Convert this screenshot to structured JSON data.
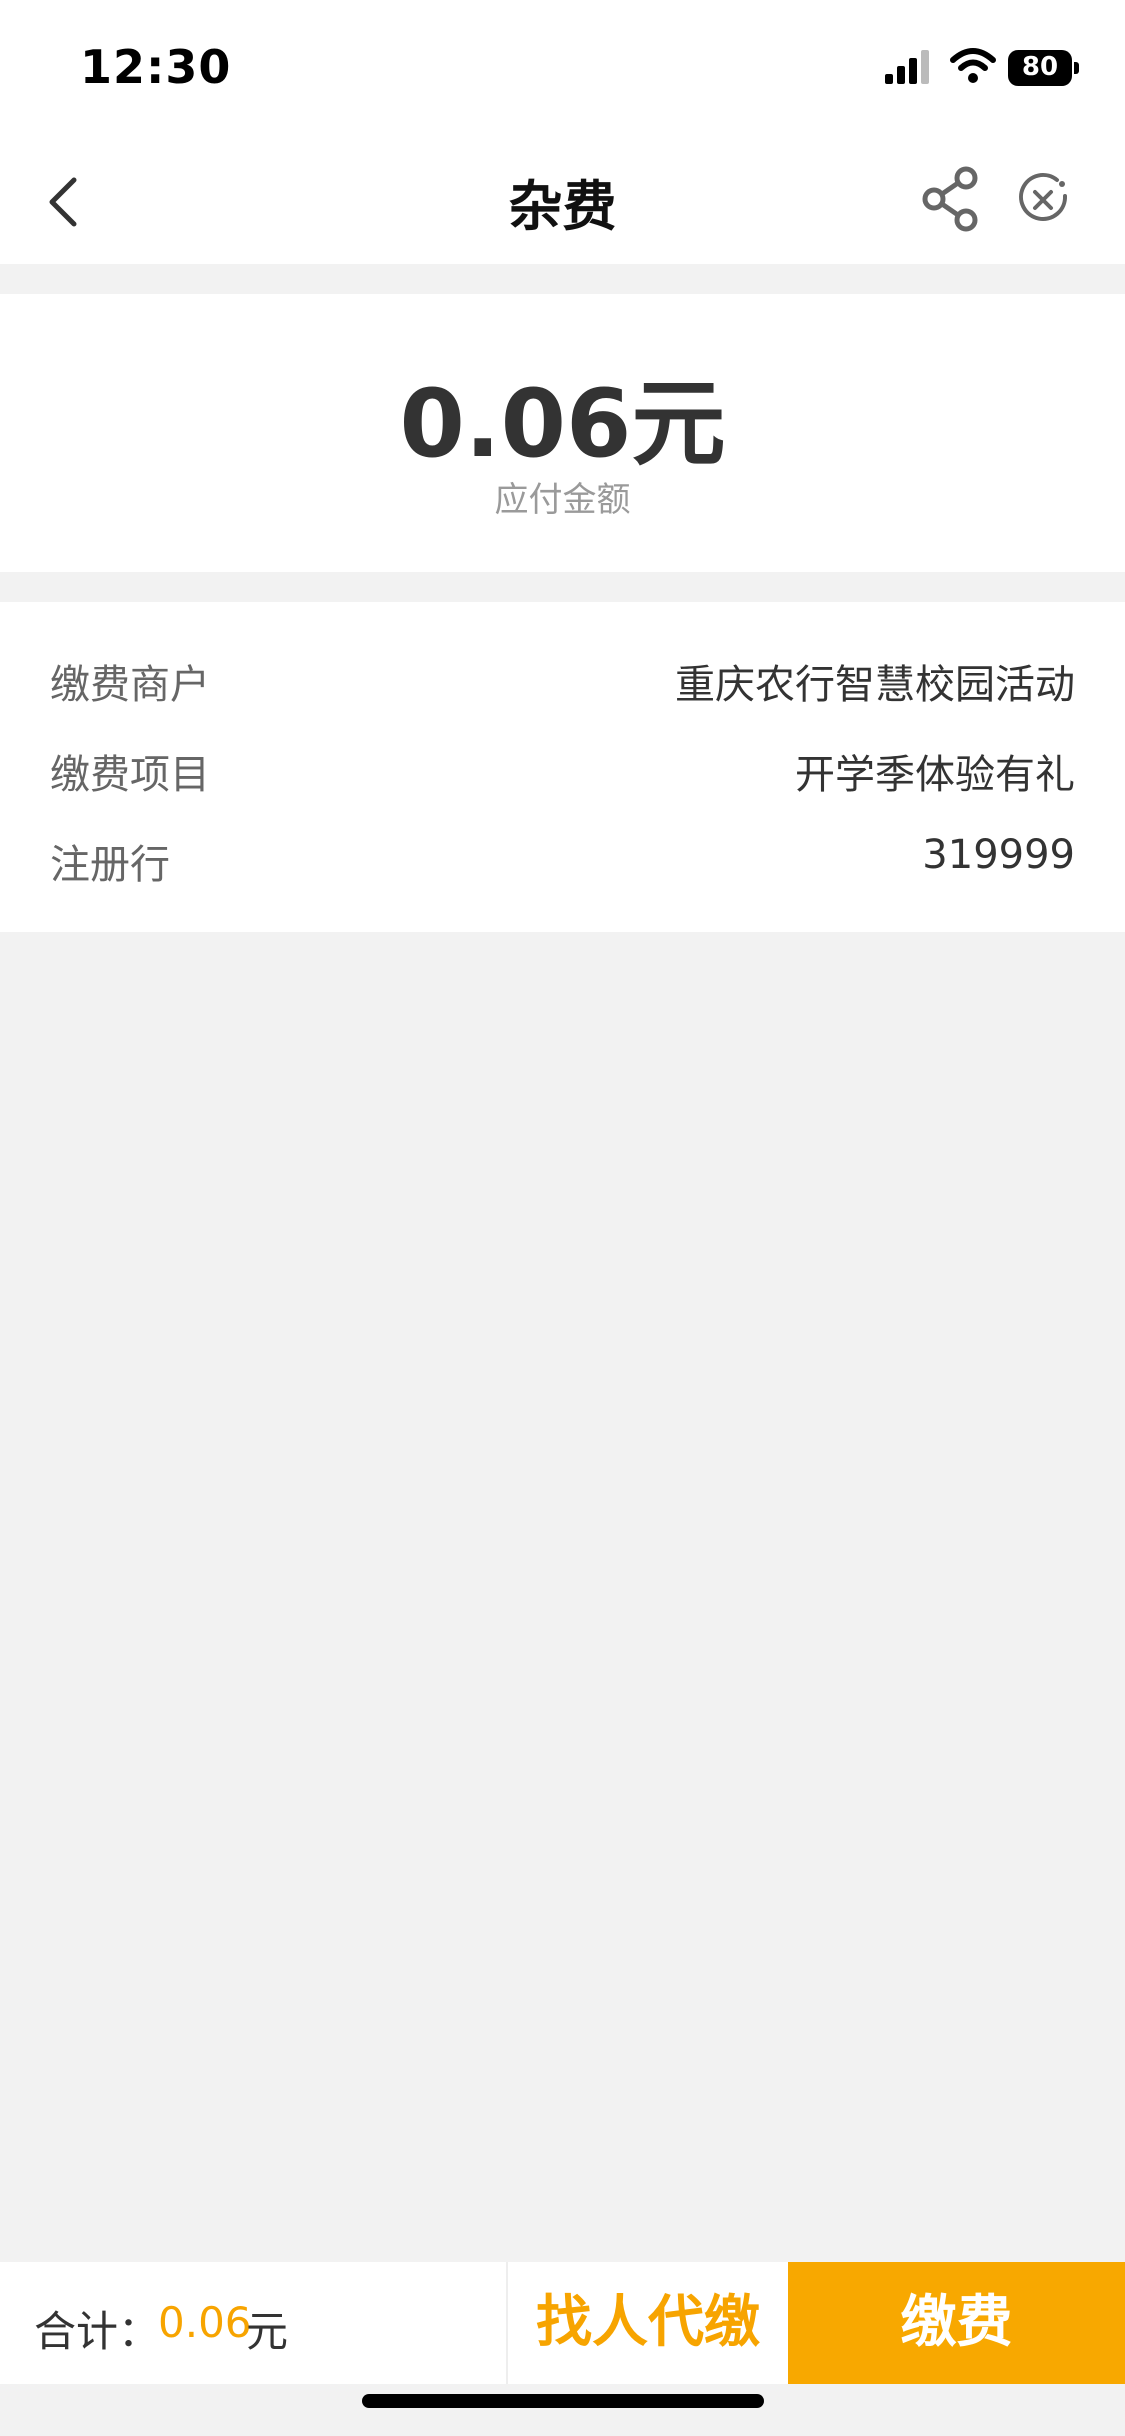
{
  "status_bar": {
    "time": "12:30",
    "battery": "80",
    "icons": [
      "signal-icon",
      "wifi-icon",
      "battery-icon"
    ]
  },
  "nav": {
    "title": "杂费",
    "icons": [
      "back-icon",
      "share-icon",
      "close-icon"
    ]
  },
  "amount_card": {
    "amount": "0.06元",
    "label": "应付金额"
  },
  "details": [
    {
      "key": "缴费商户",
      "value": "重庆农行智慧校园活动"
    },
    {
      "key": "缴费项目",
      "value": "开学季体验有礼"
    },
    {
      "key": "注册行",
      "value": "319999"
    }
  ],
  "footer": {
    "total_label": "合计：",
    "total_amount": "0.06",
    "total_unit": "元",
    "proxy_button": "找人代缴",
    "pay_button": "缴费"
  },
  "colors": {
    "accent": "#f7a400",
    "button": "#f8a800",
    "background": "#f2f2f2"
  }
}
